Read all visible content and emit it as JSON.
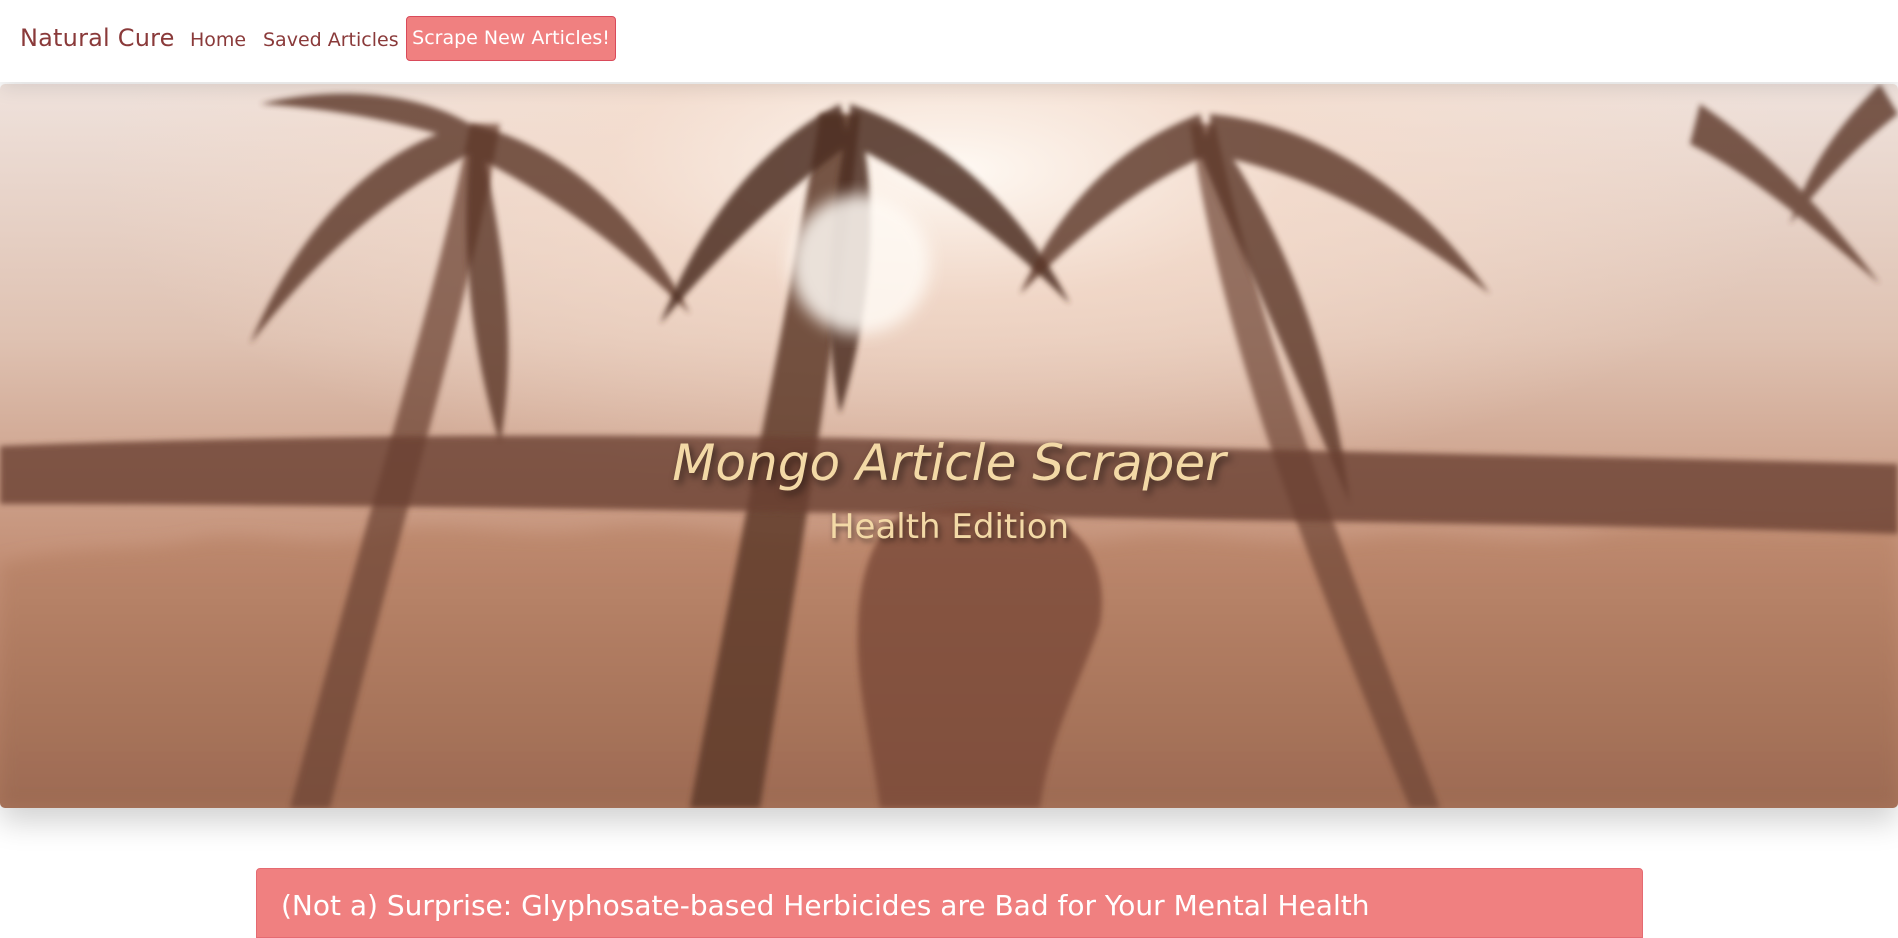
{
  "navbar": {
    "brand": "Natural Cure",
    "links": [
      "Home",
      "Saved Articles"
    ],
    "scrape_button": "Scrape New Articles!"
  },
  "hero": {
    "title": "Mongo Article Scraper",
    "subtitle": "Health Edition"
  },
  "articles": [
    {
      "title": "(Not a) Surprise: Glyphosate-based Herbicides are Bad for Your Mental Health"
    }
  ],
  "colors": {
    "accent": "#f08080",
    "brand_text": "#8a3a3a",
    "hero_text": "#f3d9a6"
  }
}
